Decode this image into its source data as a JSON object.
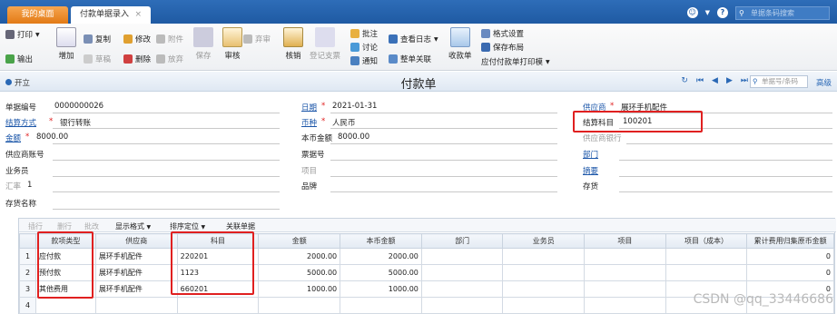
{
  "tabs": {
    "home": "我的桌面",
    "active": "付款单据录入",
    "close": "×"
  },
  "topbar": {
    "search_placeholder": "单据条码搜索"
  },
  "toolbar": {
    "print": "打印",
    "export": "输出",
    "add": "增加",
    "copy": "复制",
    "draft": "草稿",
    "modify": "修改",
    "delete": "删除",
    "attach": "附件",
    "abandon": "放弃",
    "save": "保存",
    "abandon_review": "弃审",
    "review": "审核",
    "verify": "核销",
    "register": "登记支票",
    "annotate": "批注",
    "discuss": "讨论",
    "notify": "通知",
    "view_log": "查看日志",
    "whole_link": "整单关联",
    "receive": "收款单",
    "format_settings": "格式设置",
    "save_layout": "保存布局",
    "print_template": "应付付款单打印模"
  },
  "titlebar": {
    "open": "开立",
    "title": "付款单",
    "search_placeholder": "单据号/条码",
    "advanced": "高级"
  },
  "form": {
    "doc_no_label": "单据编号",
    "doc_no": "0000000026",
    "date_label": "日期",
    "date": "2021-01-31",
    "supplier_label": "供应商",
    "supplier": "展环手机配件",
    "settle_method_label": "结算方式",
    "settle_method": "银行转账",
    "currency_label": "币种",
    "currency": "人民币",
    "settle_subject_label": "结算科目",
    "settle_subject": "100201",
    "amount_label": "金额",
    "amount": "8000.00",
    "local_amount_label": "本币金额",
    "local_amount": "8000.00",
    "supplier_bank_label": "供应商银行",
    "supplier_account_label": "供应商账号",
    "bill_no_label": "票据号",
    "dept_label": "部门",
    "salesman_label": "业务员",
    "project_label": "项目",
    "summary_label": "摘要",
    "rate_label": "汇率",
    "rate": "1",
    "brand_label": "品牌",
    "goods_label": "存货",
    "goods_name_label": "存货名称"
  },
  "grid": {
    "toolbar": {
      "insert": "插行",
      "delete": "删行",
      "batch": "批改",
      "display": "显示格式",
      "sort": "排序定位",
      "link": "关联单据"
    },
    "headers": [
      "",
      "款项类型",
      "供应商",
      "科目",
      "金额",
      "本币金额",
      "部门",
      "业务员",
      "项目",
      "项目（成本）",
      "累计费用归集原币金额"
    ],
    "rows": [
      {
        "n": "1",
        "type": "应付款",
        "supplier": "展环手机配件",
        "subject": "220201",
        "amount": "2000.00",
        "local": "2000.00",
        "cost": "0"
      },
      {
        "n": "2",
        "type": "预付款",
        "supplier": "展环手机配件",
        "subject": "1123",
        "amount": "5000.00",
        "local": "5000.00",
        "cost": "0"
      },
      {
        "n": "3",
        "type": "其他费用",
        "supplier": "展环手机配件",
        "subject": "660201",
        "amount": "1000.00",
        "local": "1000.00",
        "cost": "0"
      },
      {
        "n": "4",
        "type": "",
        "supplier": "",
        "subject": "",
        "amount": "",
        "local": "",
        "cost": ""
      }
    ]
  },
  "watermark": "CSDN @qq_33446686",
  "colors": {
    "accent": "#1f5aa3",
    "highlight_box": "#e02020",
    "home_tab": "#e27a16"
  }
}
